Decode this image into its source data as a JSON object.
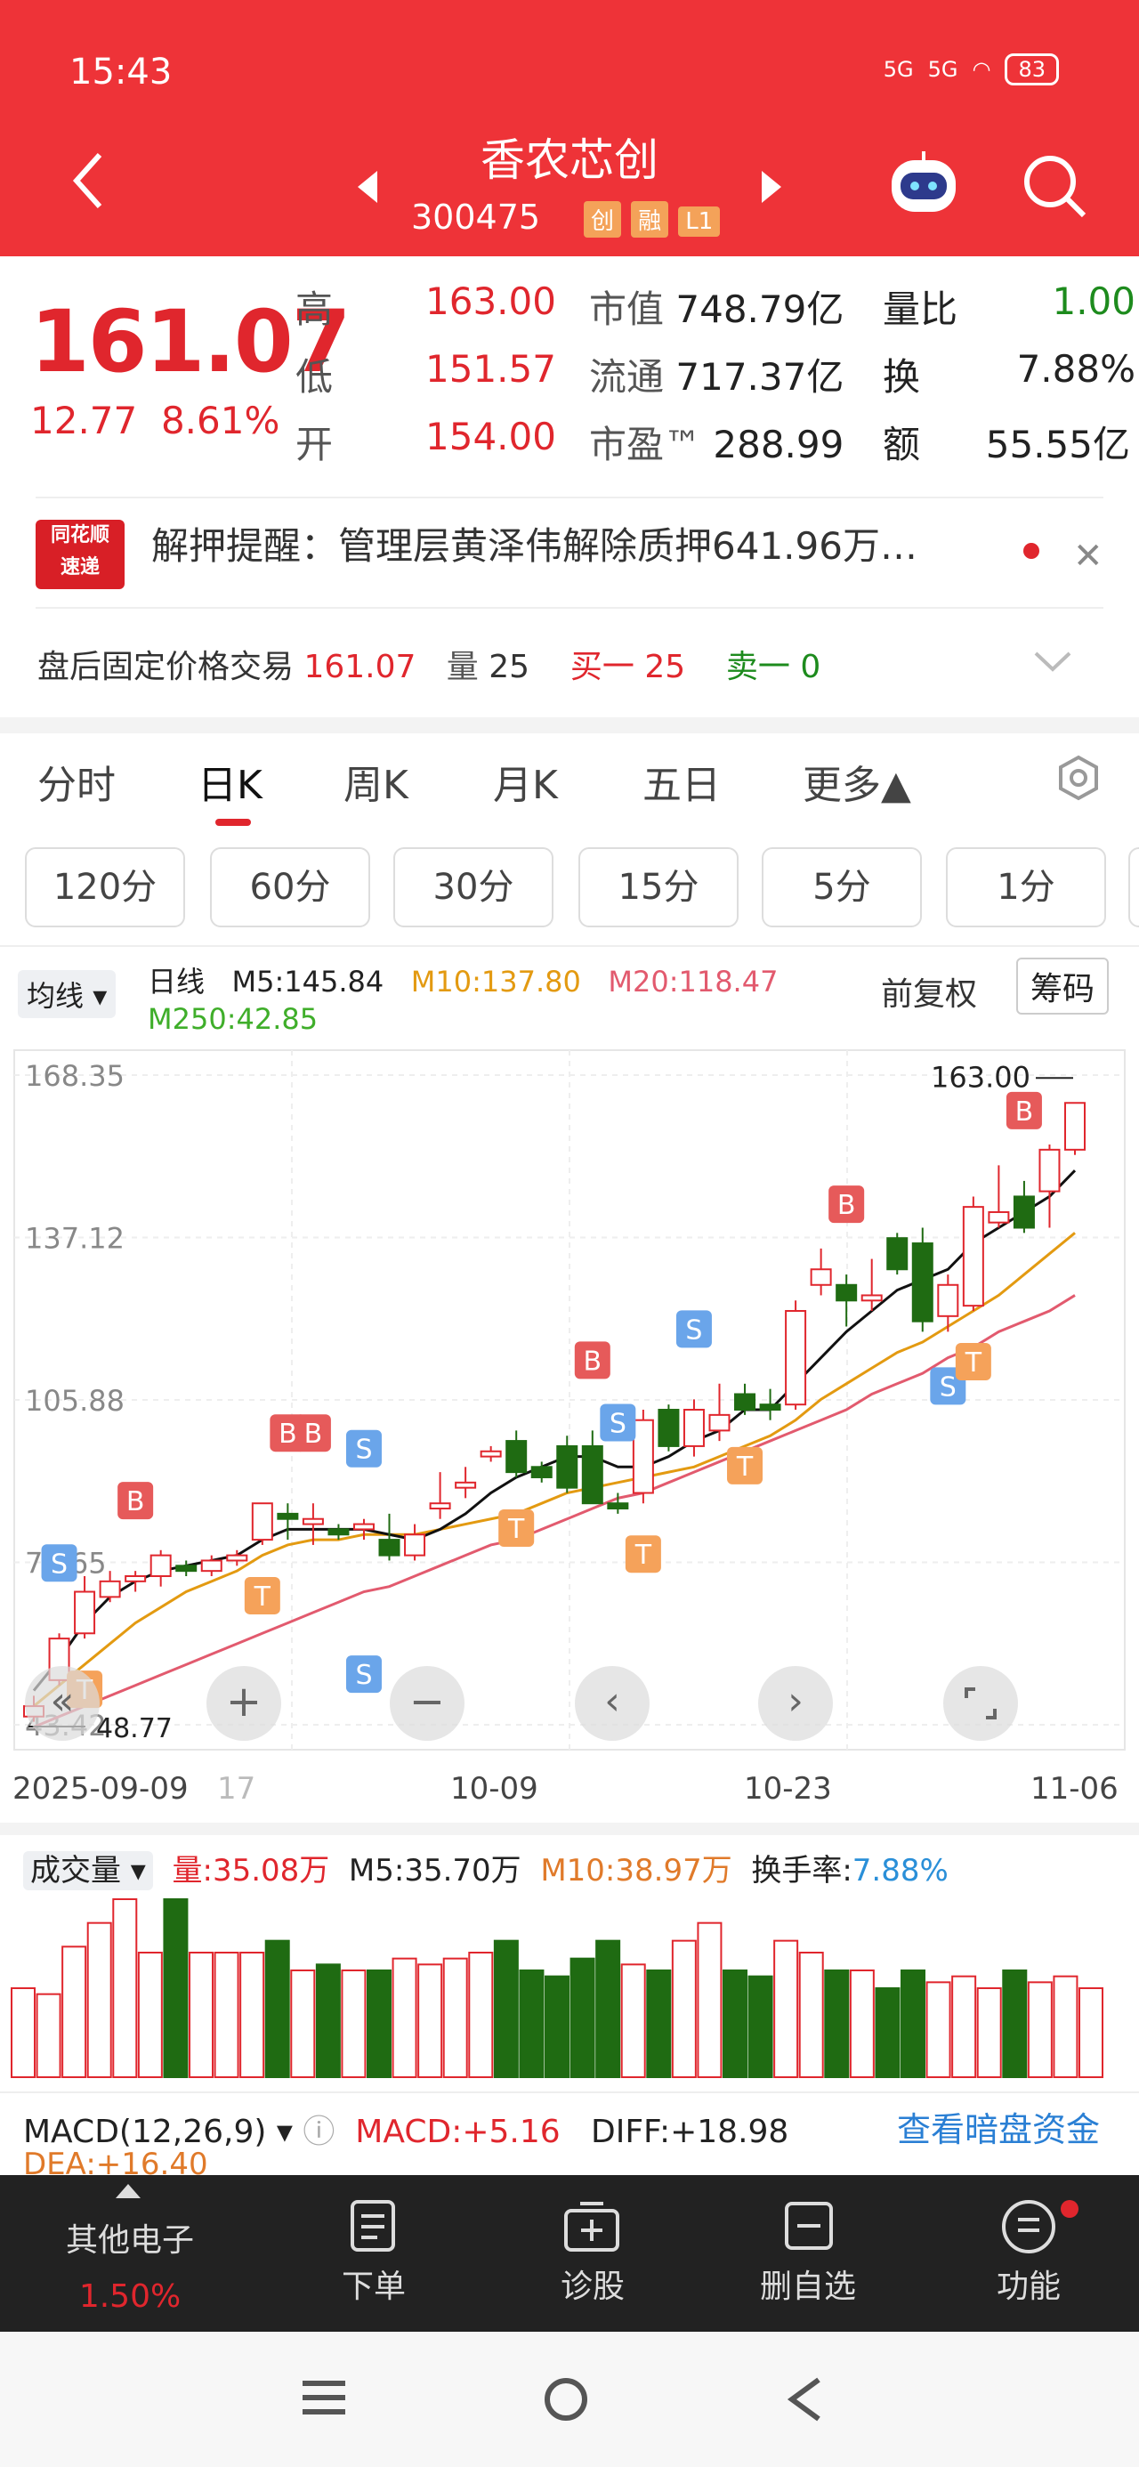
{
  "status": {
    "time": "15:43",
    "battery": "83",
    "net1": "5G",
    "net2": "5G"
  },
  "header": {
    "title": "香农芯创",
    "code": "300475",
    "tags": [
      "创",
      "融",
      "L1"
    ]
  },
  "quote": {
    "price": "161.07",
    "change": "12.77",
    "change_pct": "8.61%",
    "high_label": "高",
    "high": "163.00",
    "low_label": "低",
    "low": "151.57",
    "open_label": "开",
    "open": "154.00",
    "mktcap_label": "市值",
    "mktcap": "748.79亿",
    "float_label": "流通",
    "float": "717.37亿",
    "pe_label": "市盈™",
    "pe": "288.99",
    "vr_label": "量比",
    "vr": "1.00",
    "turn_label": "换",
    "turn": "7.88%",
    "amount_label": "额",
    "amount": "55.55亿"
  },
  "news": {
    "logo_top": "同花顺",
    "logo_bottom": "速递",
    "text": "解押提醒：管理层黄泽伟解除质押641.96万…"
  },
  "after_hours": {
    "label": "盘后固定价格交易",
    "price": "161.07",
    "vol_label": "量",
    "vol": "25",
    "buy_label": "买一",
    "buy": "25",
    "sell_label": "卖一",
    "sell": "0"
  },
  "tabs": [
    "分时",
    "日K",
    "周K",
    "月K",
    "五日",
    "更多▲"
  ],
  "periods": [
    "120分",
    "60分",
    "30分",
    "15分",
    "5分",
    "1分"
  ],
  "chart_info": {
    "ma_selector": "均线",
    "period": "日线",
    "m5": "M5:145.84",
    "m10": "M10:137.80",
    "m20": "M20:118.47",
    "m250": "M250:42.85",
    "adjust": "前复权",
    "chips": "筹码"
  },
  "chart_data": {
    "type": "candlestick",
    "ylim": [
      43.42,
      168.35
    ],
    "y_ticks": [
      "168.35",
      "137.12",
      "105.88",
      "74.65",
      "43.42"
    ],
    "x_ticks": [
      "2025-09-09",
      "17",
      "10-09",
      "10-23",
      "11-06"
    ],
    "max_label": "163.00",
    "min_label": "48.77",
    "candles": [
      [
        45,
        47,
        44,
        49
      ],
      [
        52,
        60,
        51,
        61
      ],
      [
        61,
        69,
        60,
        72
      ],
      [
        68,
        71,
        67,
        73
      ],
      [
        71,
        72,
        69,
        73
      ],
      [
        72,
        76,
        70,
        77
      ],
      [
        74,
        73,
        72,
        75
      ],
      [
        73,
        75,
        72,
        76
      ],
      [
        75,
        76,
        74,
        77
      ],
      [
        79,
        86,
        78,
        86
      ],
      [
        84,
        83,
        79,
        86
      ],
      [
        82,
        83,
        78,
        86
      ],
      [
        81,
        80,
        79,
        82
      ],
      [
        81,
        82,
        79,
        83
      ],
      [
        79,
        76,
        75,
        84
      ],
      [
        76,
        80,
        75,
        82
      ],
      [
        85,
        86,
        83,
        92
      ],
      [
        89,
        90,
        87,
        93
      ],
      [
        95,
        96,
        94,
        97
      ],
      [
        98,
        92,
        91,
        100
      ],
      [
        93,
        91,
        90,
        94
      ],
      [
        97,
        89,
        88,
        99
      ],
      [
        97,
        86,
        87,
        100
      ],
      [
        86,
        85,
        84,
        88
      ],
      [
        88,
        102,
        86,
        104
      ],
      [
        104,
        97,
        96,
        105
      ],
      [
        97,
        104,
        95,
        106
      ],
      [
        100,
        103,
        98,
        109
      ],
      [
        107,
        104,
        103,
        109
      ],
      [
        105,
        104,
        102,
        108
      ],
      [
        105,
        123,
        104,
        125
      ],
      [
        128,
        131,
        126,
        135
      ],
      [
        128,
        125,
        120,
        130
      ],
      [
        125,
        126,
        123,
        133
      ],
      [
        137,
        131,
        130,
        138
      ],
      [
        136,
        121,
        119,
        139
      ],
      [
        122,
        128,
        119,
        130
      ],
      [
        124,
        143,
        123,
        145
      ],
      [
        140,
        142,
        139,
        151
      ],
      [
        145,
        139,
        138,
        148
      ],
      [
        146,
        154,
        139,
        155
      ],
      [
        154,
        163,
        153,
        163
      ]
    ],
    "ma5": [
      50,
      56,
      63,
      68,
      71,
      73,
      74,
      75,
      76,
      79,
      81,
      81,
      81,
      81,
      80,
      79,
      81,
      84,
      88,
      91,
      93,
      95,
      95,
      93,
      93,
      95,
      98,
      100,
      104,
      104,
      109,
      114,
      119,
      123,
      127,
      129,
      131,
      136,
      139,
      142,
      145,
      150
    ],
    "ma10": [
      47,
      51,
      55,
      59,
      63,
      66,
      69,
      71,
      73,
      76,
      78,
      79,
      79,
      80,
      80,
      80,
      81,
      82,
      83,
      84,
      86,
      88,
      89,
      90,
      91,
      92,
      93,
      95,
      97,
      99,
      102,
      106,
      109,
      112,
      115,
      117,
      120,
      123,
      126,
      130,
      134,
      138
    ],
    "ma20": [
      43,
      45,
      47,
      49,
      51,
      53,
      55,
      57,
      59,
      61,
      63,
      65,
      67,
      69,
      70,
      72,
      74,
      76,
      78,
      79,
      81,
      83,
      85,
      87,
      88,
      90,
      92,
      94,
      96,
      98,
      100,
      102,
      104,
      107,
      109,
      111,
      114,
      116,
      119,
      121,
      123,
      126
    ],
    "signals": [
      {
        "i": 1,
        "t": "S"
      },
      {
        "i": 2,
        "t": "T"
      },
      {
        "i": 4,
        "t": "B"
      },
      {
        "i": 9,
        "t": "T"
      },
      {
        "i": 10,
        "t": "B"
      },
      {
        "i": 11,
        "t": "B"
      },
      {
        "i": 13,
        "t": "S"
      },
      {
        "i": 13,
        "t": "S"
      },
      {
        "i": 19,
        "t": "T"
      },
      {
        "i": 22,
        "t": "B"
      },
      {
        "i": 23,
        "t": "S"
      },
      {
        "i": 24,
        "t": "T"
      },
      {
        "i": 26,
        "t": "S"
      },
      {
        "i": 28,
        "t": "T"
      },
      {
        "i": 32,
        "t": "B"
      },
      {
        "i": 36,
        "t": "S"
      },
      {
        "i": 37,
        "t": "T"
      },
      {
        "i": 39,
        "t": "B"
      }
    ],
    "volume": {
      "label": "成交量",
      "vol": "量:35.08万",
      "m5": "M5:35.70万",
      "m10": "M10:38.97万",
      "turnover_label": "换手率:",
      "turnover": "7.88%",
      "bars": [
        30,
        28,
        44,
        52,
        60,
        42,
        60,
        42,
        42,
        42,
        46,
        36,
        38,
        36,
        36,
        40,
        38,
        40,
        42,
        46,
        36,
        34,
        40,
        46,
        38,
        36,
        46,
        52,
        36,
        34,
        46,
        42,
        36,
        36,
        30,
        36,
        32,
        34,
        30,
        36,
        32,
        34,
        30
      ]
    },
    "macd": {
      "label": "MACD(12,26,9)",
      "macd": "MACD:+5.16",
      "diff": "DIFF:+18.98",
      "dea": "DEA:+16.40",
      "link": "查看暗盘资金"
    }
  },
  "bottom_bar": {
    "sector": "其他电子",
    "sector_pct": "1.50%",
    "order": "下单",
    "diagnose": "诊股",
    "delete": "删自选",
    "func": "功能"
  }
}
